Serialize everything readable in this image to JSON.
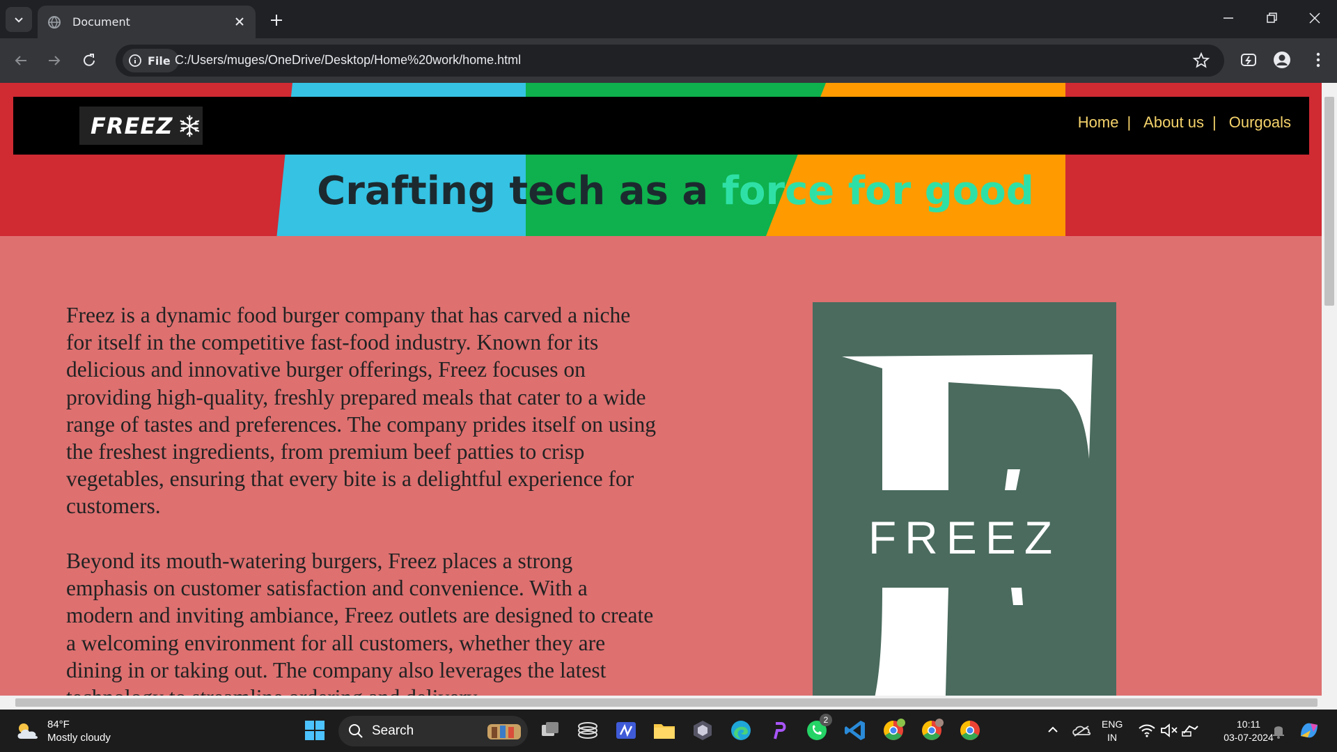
{
  "browser": {
    "tab_title": "Document",
    "site_chip": "File",
    "url": "C:/Users/muges/OneDrive/Desktop/Home%20work/home.html"
  },
  "page": {
    "logo_text": "FREEZ",
    "nav": [
      {
        "label": "Home"
      },
      {
        "label": "About us"
      },
      {
        "label": "Ourgoals"
      }
    ],
    "separator": "|",
    "headline_part1": "Crafting tech as a ",
    "headline_part2": "force for good",
    "paragraph1": "Freez is a dynamic food burger company that has carved a niche for itself in the competitive fast-food industry. Known for its delicious and innovative burger offerings, Freez focuses on providing high-quality, freshly prepared meals that cater to a wide range of tastes and preferences. The company prides itself on using the freshest ingredients, from premium beef patties to crisp vegetables, ensuring that every bite is a delightful experience for customers.",
    "paragraph2": "Beyond its mouth-watering burgers, Freez places a strong emphasis on customer satisfaction and convenience. With a modern and inviting ambiance, Freez outlets are designed to create a welcoming environment for all customers, whether they are dining in or taking out. The company also leverages the latest technology to streamline ordering and delivery",
    "image_brand_text": "FREEZ",
    "colors": {
      "background": "#de7070",
      "nav_bg": "#000000",
      "nav_link": "#f5d36b",
      "headline_dark": "#1c2a2f",
      "headline_accent": "#2fe0a6",
      "image_bg": "#4a6b5e"
    }
  },
  "taskbar": {
    "weather_temp": "84°F",
    "weather_desc": "Mostly cloudy",
    "search_label": "Search",
    "lang_line1": "ENG",
    "lang_line2": "IN",
    "time": "10:11",
    "date": "03-07-2024",
    "whatsapp_badge": "2"
  }
}
